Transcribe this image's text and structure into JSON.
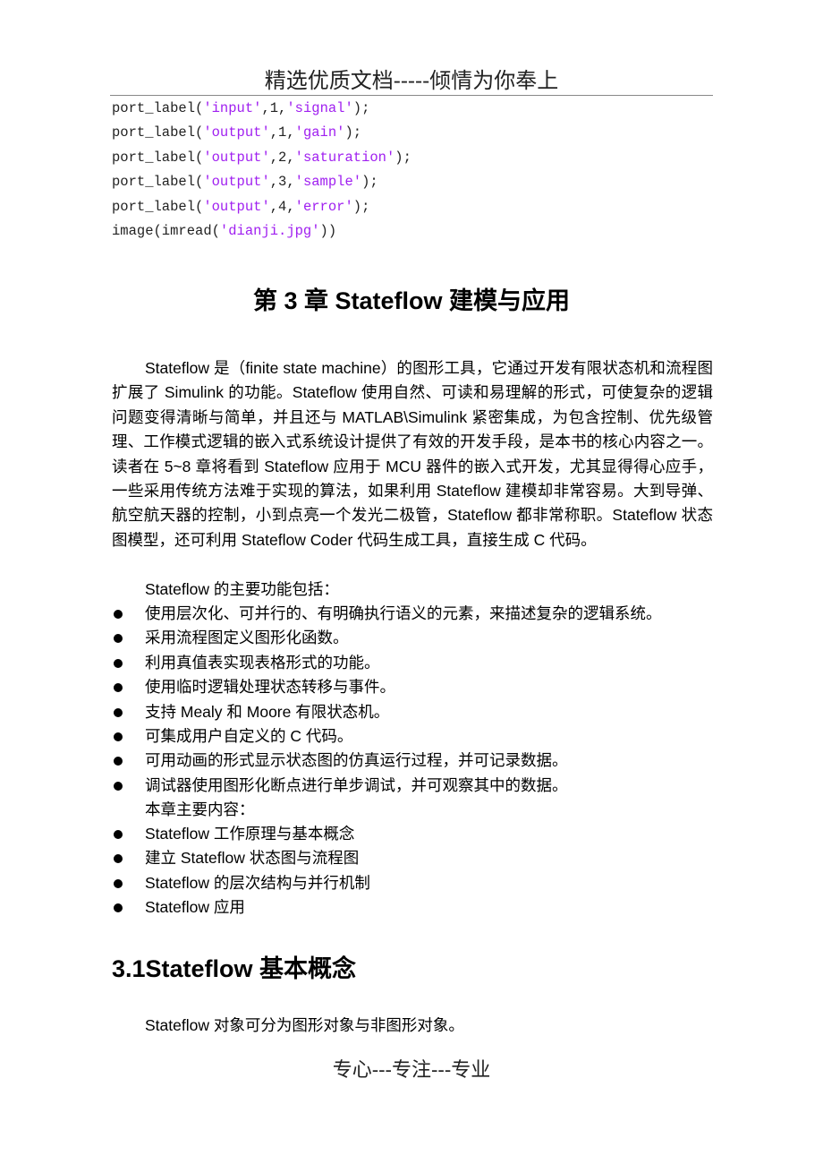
{
  "header": {
    "text": "精选优质文档-----倾情为你奉上"
  },
  "code": {
    "lines": [
      {
        "pre": "port_label(",
        "s1": "'input'",
        "mid": ",1,",
        "s2": "'signal'",
        "post": ");"
      },
      {
        "pre": "port_label(",
        "s1": "'output'",
        "mid": ",1,",
        "s2": "'gain'",
        "post": ");"
      },
      {
        "pre": "port_label(",
        "s1": "'output'",
        "mid": ",2,",
        "s2": "'saturation'",
        "post": ");"
      },
      {
        "pre": "port_label(",
        "s1": "'output'",
        "mid": ",3,",
        "s2": "'sample'",
        "post": ");"
      },
      {
        "pre": "port_label(",
        "s1": "'output'",
        "mid": ",4,",
        "s2": "'error'",
        "post": ");"
      },
      {
        "pre": "image(imread(",
        "s1": "'dianji.jpg'",
        "mid": "",
        "s2": "",
        "post": "))"
      }
    ],
    "string_color": "#a020f0"
  },
  "chapter": {
    "title": "第 3 章 Stateflow 建模与应用",
    "paragraph": "Stateflow 是（finite state machine）的图形工具，它通过开发有限状态机和流程图扩展了 Simulink 的功能。Stateflow 使用自然、可读和易理解的形式，可使复杂的逻辑问题变得清晰与简单，并且还与 MATLAB\\Simulink 紧密集成，为包含控制、优先级管理、工作模式逻辑的嵌入式系统设计提供了有效的开发手段，是本书的核心内容之一。读者在 5~8 章将看到 Stateflow 应用于 MCU 器件的嵌入式开发，尤其显得得心应手，一些采用传统方法难于实现的算法，如果利用 Stateflow 建模却非常容易。大到导弹、航空航天器的控制，小到点亮一个发光二极管，Stateflow 都非常称职。Stateflow 状态图模型，还可利用 Stateflow Coder 代码生成工具，直接生成 C 代码。",
    "features_intro": "Stateflow 的主要功能包括：",
    "features": [
      "使用层次化、可并行的、有明确执行语义的元素，来描述复杂的逻辑系统。",
      "采用流程图定义图形化函数。",
      "利用真值表实现表格形式的功能。",
      "使用临时逻辑处理状态转移与事件。",
      "支持 Mealy 和 Moore 有限状态机。",
      "可集成用户自定义的 C 代码。",
      "可用动画的形式显示状态图的仿真运行过程，并可记录数据。",
      "调试器使用图形化断点进行单步调试，并可观察其中的数据。"
    ],
    "contents_intro": "本章主要内容：",
    "contents": [
      "Stateflow 工作原理与基本概念",
      "建立 Stateflow 状态图与流程图",
      "Stateflow 的层次结构与并行机制",
      "Stateflow 应用"
    ]
  },
  "section": {
    "title": "3.1Stateflow 基本概念",
    "paragraph": "Stateflow 对象可分为图形对象与非图形对象。"
  },
  "footer": {
    "text": "专心---专注---专业"
  }
}
